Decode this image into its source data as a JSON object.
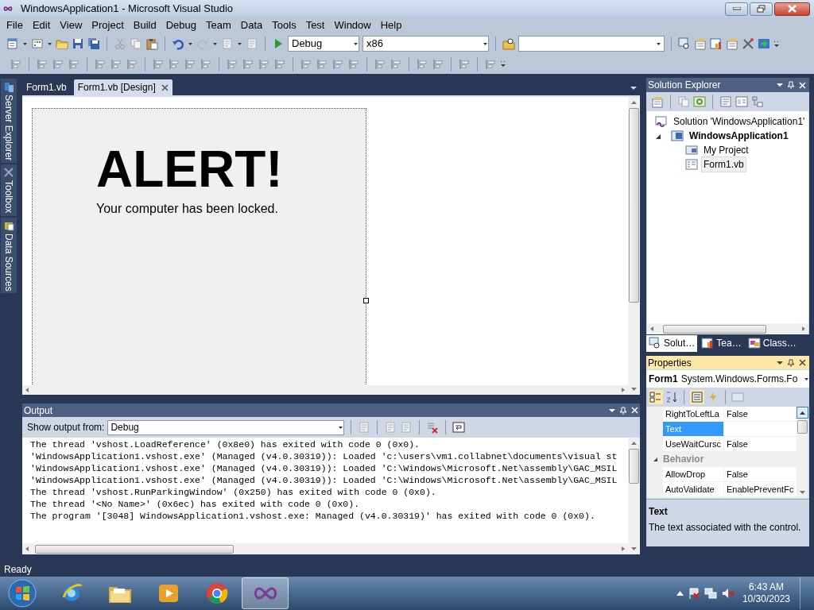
{
  "window": {
    "title": "WindowsApplication1 - Microsoft Visual Studio"
  },
  "menu": [
    "File",
    "Edit",
    "View",
    "Project",
    "Build",
    "Debug",
    "Team",
    "Data",
    "Tools",
    "Test",
    "Window",
    "Help"
  ],
  "toolbar": {
    "configuration": "Debug",
    "platform": "x86"
  },
  "side_tabs": [
    "Server Explorer",
    "Toolbox",
    "Data Sources"
  ],
  "document_tabs": [
    {
      "label": "Form1.vb",
      "selected": false
    },
    {
      "label": "Form1.vb [Design]",
      "selected": true
    }
  ],
  "form": {
    "heading": "ALERT!",
    "message": "Your computer has been locked."
  },
  "output": {
    "title": "Output",
    "source_label": "Show output from:",
    "source": "Debug",
    "lines": [
      "The thread 'vshost.LoadReference' (0x8e0) has exited with code 0 (0x0).",
      "'WindowsApplication1.vshost.exe' (Managed (v4.0.30319)): Loaded 'c:\\users\\vm1.collabnet\\documents\\visual st",
      "'WindowsApplication1.vshost.exe' (Managed (v4.0.30319)): Loaded 'C:\\Windows\\Microsoft.Net\\assembly\\GAC_MSIL",
      "'WindowsApplication1.vshost.exe' (Managed (v4.0.30319)): Loaded 'C:\\Windows\\Microsoft.Net\\assembly\\GAC_MSIL",
      "The thread 'vshost.RunParkingWindow' (0x250) has exited with code 0 (0x0).",
      "The thread '<No Name>' (0x6ec) has exited with code 0 (0x0).",
      "The program '[3048] WindowsApplication1.vshost.exe: Managed (v4.0.30319)' has exited with code 0 (0x0)."
    ]
  },
  "solution_explorer": {
    "title": "Solution Explorer",
    "tree": [
      {
        "kind": "solution",
        "label": "Solution 'WindowsApplication1'",
        "bold": false,
        "selected": false,
        "children": [
          {
            "kind": "project",
            "label": "WindowsApplication1",
            "bold": true,
            "selected": false,
            "expanded": true,
            "children": [
              {
                "kind": "folder",
                "label": "My Project",
                "bold": false,
                "selected": false
              },
              {
                "kind": "form",
                "label": "Form1.vb",
                "bold": false,
                "selected": true
              }
            ]
          }
        ]
      }
    ],
    "tabs": [
      {
        "label": "Solut…",
        "selected": true
      },
      {
        "label": "Tea…",
        "selected": false
      },
      {
        "label": "Class…",
        "selected": false
      }
    ]
  },
  "properties": {
    "title": "Properties",
    "object": "Form1",
    "type": "System.Windows.Forms.Fo",
    "rows": [
      {
        "kind": "property",
        "name": "RightToLeftLa",
        "value": "False",
        "selected": false
      },
      {
        "kind": "property",
        "name": "Text",
        "selected": true
      },
      {
        "kind": "property",
        "name": "UseWaitCursc",
        "value": "False",
        "selected": false
      },
      {
        "kind": "category",
        "name": "Behavior",
        "expanded": true
      },
      {
        "kind": "property",
        "name": "AllowDrop",
        "value": "False",
        "selected": false
      },
      {
        "kind": "property",
        "name": "AutoValidate",
        "value": "EnablePreventFc",
        "selected": false
      }
    ],
    "description_title": "Text",
    "description": "The text associated with the control."
  },
  "status_bar": "Ready",
  "taskbar": {
    "apps": [
      {
        "kind": "browser-e",
        "selected": false
      },
      {
        "kind": "folders",
        "selected": false
      },
      {
        "kind": "media",
        "selected": false
      },
      {
        "kind": "browser-c",
        "selected": false
      },
      {
        "kind": "studio",
        "selected": true
      }
    ],
    "time": "6:43 AM",
    "date": "10/30/2023"
  }
}
